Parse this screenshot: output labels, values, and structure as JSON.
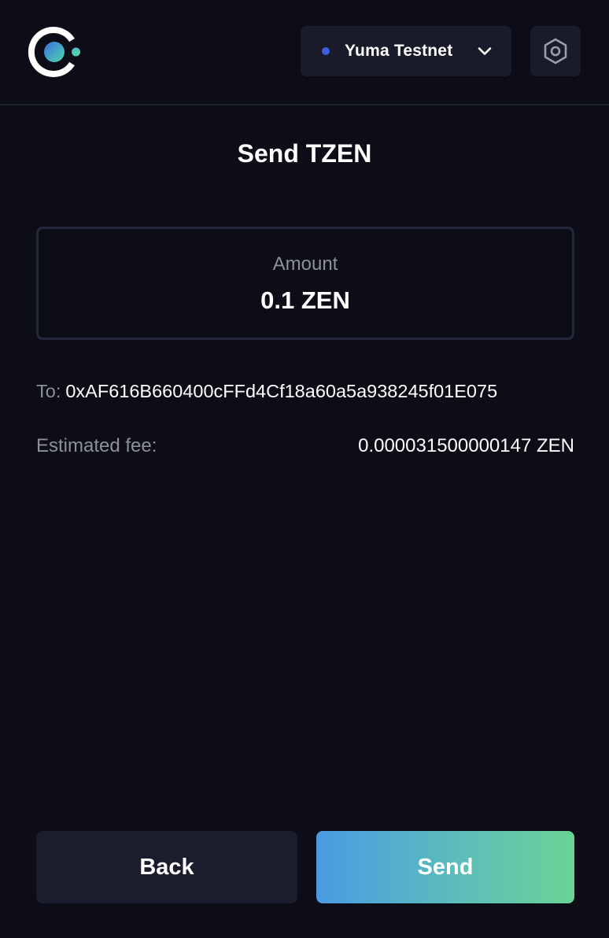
{
  "header": {
    "logo_icon": "celo-style-logo-icon",
    "network": {
      "label": "Yuma Testnet",
      "status_dot_color": "#3d5ee0",
      "dropdown_icon": "chevron-down-icon"
    },
    "settings_icon": "hexagon-gear-icon"
  },
  "page": {
    "title": "Send TZEN"
  },
  "amount": {
    "label": "Amount",
    "value": "0.1 ZEN"
  },
  "recipient": {
    "label": "To:",
    "address": "0xAF616B660400cFFd4Cf18a60a5a938245f01E075"
  },
  "fee": {
    "label": "Estimated fee:",
    "value": "0.000031500000147 ZEN"
  },
  "actions": {
    "back_label": "Back",
    "send_label": "Send"
  },
  "colors": {
    "background": "#0d0d18",
    "surface": "#191b2b",
    "muted_text": "#8d8f9d",
    "send_gradient_start": "#4a9be3",
    "send_gradient_end": "#69d495"
  }
}
